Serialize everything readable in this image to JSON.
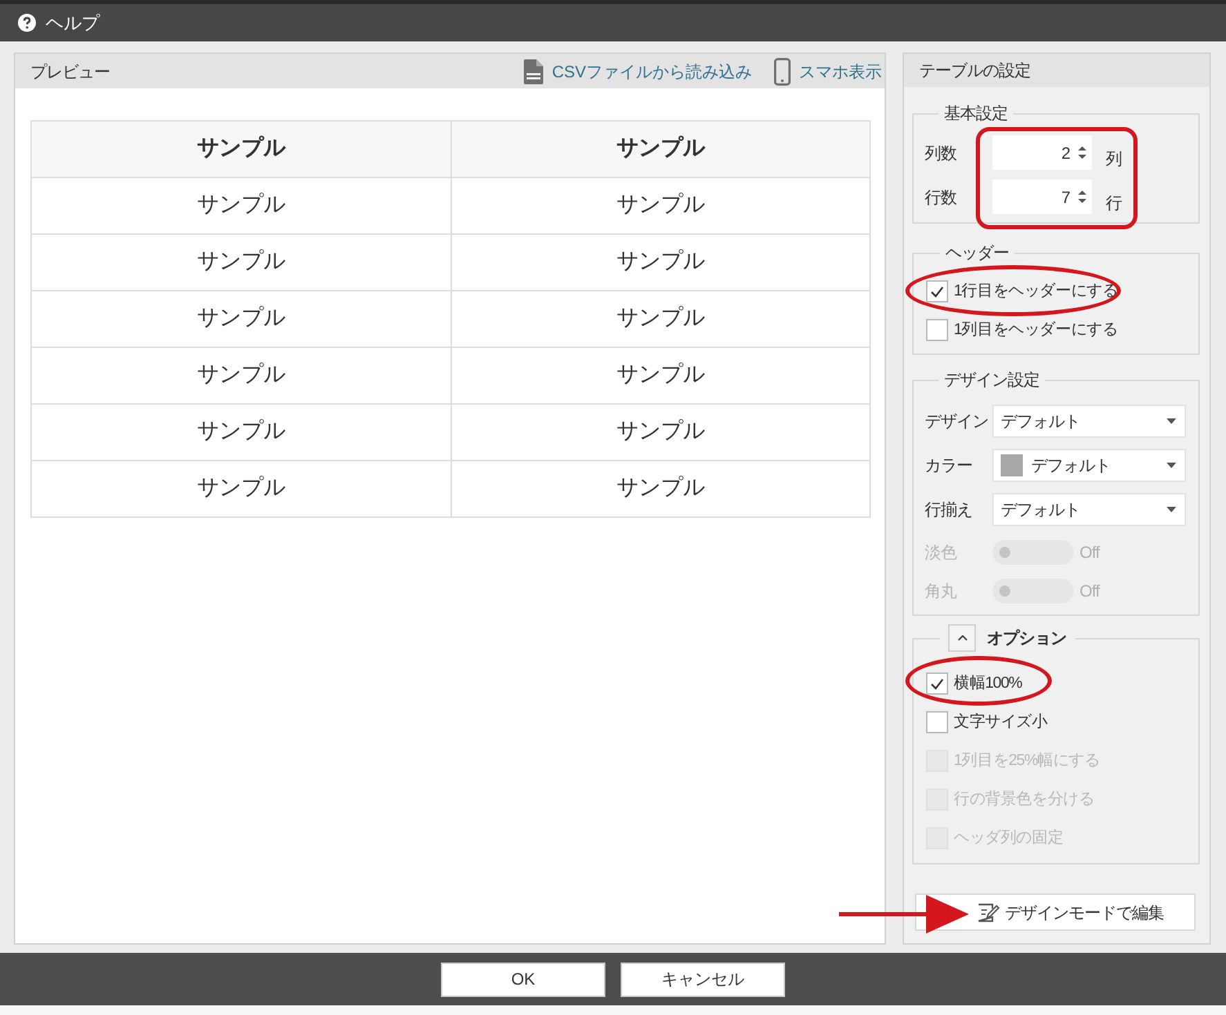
{
  "window": {
    "title": "ヘルプ"
  },
  "preview": {
    "title": "プレビュー",
    "actions": [
      {
        "kind": "csv",
        "label": "CSVファイルから読み込み"
      },
      {
        "kind": "phone",
        "label": "スマホ表示"
      }
    ],
    "table": {
      "header": [
        "サンプル",
        "サンプル"
      ],
      "rows": [
        [
          "サンプル",
          "サンプル"
        ],
        [
          "サンプル",
          "サンプル"
        ],
        [
          "サンプル",
          "サンプル"
        ],
        [
          "サンプル",
          "サンプル"
        ],
        [
          "サンプル",
          "サンプル"
        ],
        [
          "サンプル",
          "サンプル"
        ]
      ]
    }
  },
  "settings": {
    "title": "テーブルの設定",
    "basic": {
      "legend": "基本設定",
      "fields": [
        {
          "label": "列数",
          "value": "2",
          "unit": "列"
        },
        {
          "label": "行数",
          "value": "7",
          "unit": "行"
        }
      ]
    },
    "header": {
      "legend": "ヘッダー",
      "options": [
        {
          "label": "1行目をヘッダーにする",
          "checked": true,
          "disabled": false
        },
        {
          "label": "1列目をヘッダーにする",
          "checked": false,
          "disabled": false
        }
      ]
    },
    "design": {
      "legend": "デザイン設定",
      "rows": [
        {
          "kind": "select",
          "label": "デザイン",
          "value": "デフォルト"
        },
        {
          "kind": "select",
          "label": "カラー",
          "value": "デフォルト",
          "color": "#a8a8a8"
        },
        {
          "kind": "select",
          "label": "行揃え",
          "value": "デフォルト"
        },
        {
          "kind": "toggle",
          "label": "淡色",
          "on": false,
          "disabled": true,
          "state": "Off"
        },
        {
          "kind": "toggle",
          "label": "角丸",
          "on": false,
          "disabled": true,
          "state": "Off"
        }
      ]
    },
    "options": {
      "legend": "オプション",
      "expanded": true,
      "items": [
        {
          "label": "横幅100%",
          "checked": true,
          "disabled": false
        },
        {
          "label": "文字サイズ小",
          "checked": false,
          "disabled": false
        },
        {
          "label": "1列目を25%幅にする",
          "checked": false,
          "disabled": true
        },
        {
          "label": "行の背景色を分ける",
          "checked": false,
          "disabled": true
        },
        {
          "label": "ヘッダ列の固定",
          "checked": false,
          "disabled": true
        }
      ]
    },
    "edit_button": {
      "label": "デザインモードで編集"
    }
  },
  "footer": {
    "buttons": [
      {
        "label": "OK"
      },
      {
        "label": "キャンセル"
      }
    ]
  }
}
